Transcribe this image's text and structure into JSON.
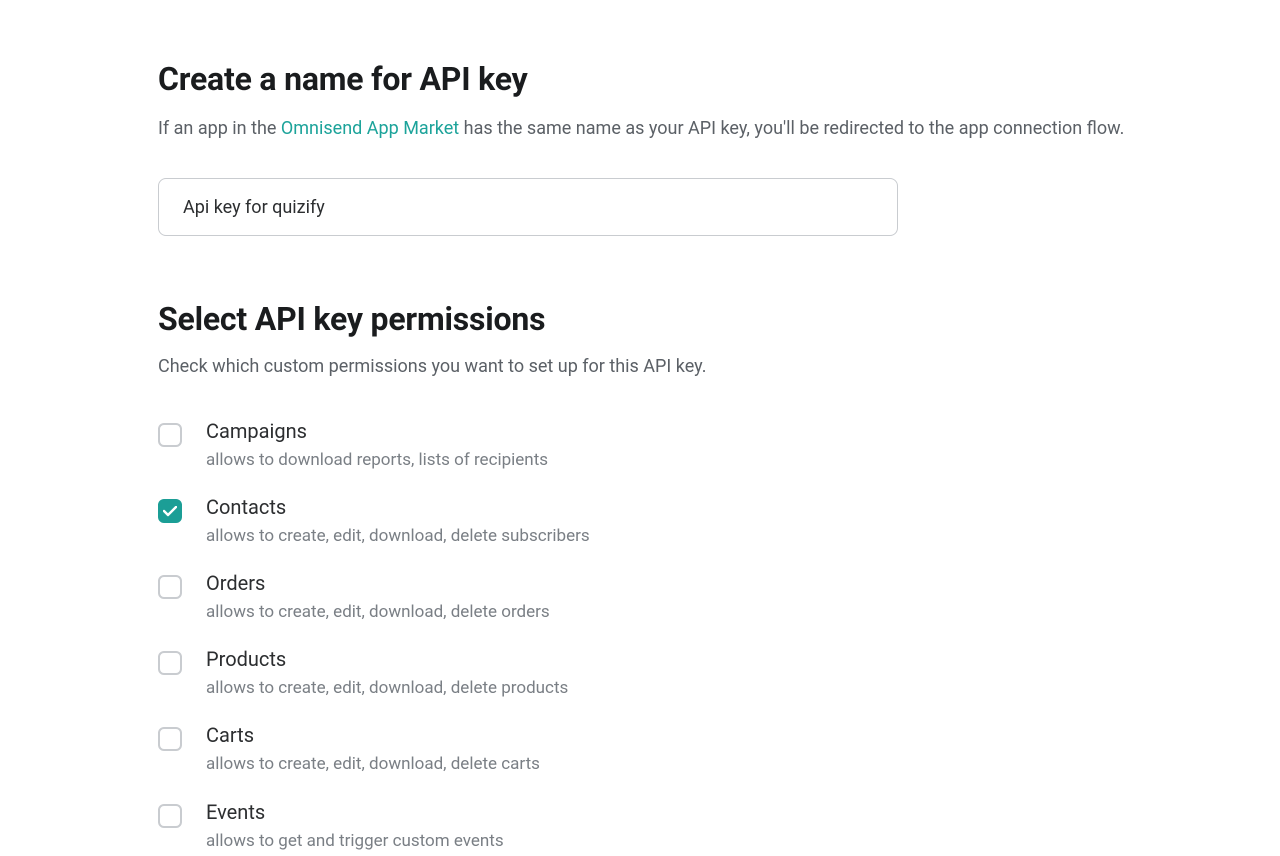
{
  "section1": {
    "heading": "Create a name for API key",
    "intro_before": "If an app in the ",
    "intro_link": "Omnisend App Market",
    "intro_after": " has the same name as your API key, you'll be redirected to the app connection flow.",
    "input_value": "Api key for quizify"
  },
  "section2": {
    "heading": "Select API key permissions",
    "sub": "Check which custom permissions you want to set up for this API key."
  },
  "permissions": [
    {
      "title": "Campaigns",
      "desc": "allows to download reports, lists of recipients",
      "checked": false
    },
    {
      "title": "Contacts",
      "desc": "allows to create, edit, download, delete subscribers",
      "checked": true
    },
    {
      "title": "Orders",
      "desc": "allows to create, edit, download, delete orders",
      "checked": false
    },
    {
      "title": "Products",
      "desc": "allows to create, edit, download, delete products",
      "checked": false
    },
    {
      "title": "Carts",
      "desc": "allows to create, edit, download, delete carts",
      "checked": false
    },
    {
      "title": "Events",
      "desc": "allows to get and trigger custom events",
      "checked": false
    }
  ]
}
